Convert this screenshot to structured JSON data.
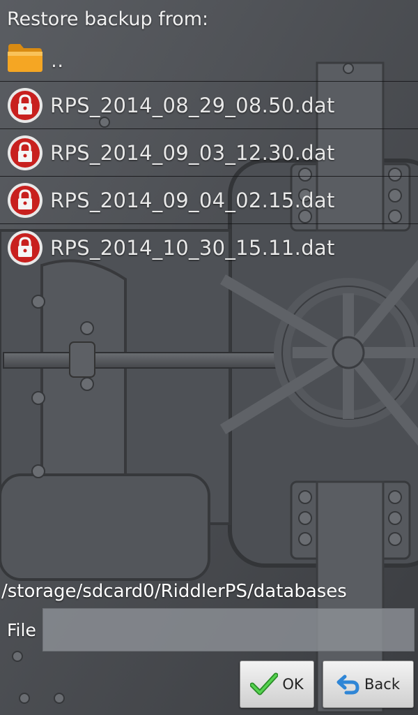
{
  "header": {
    "title": "Restore backup from:"
  },
  "list": {
    "parent_label": "..",
    "files": [
      {
        "name": "RPS_2014_08_29_08.50.dat"
      },
      {
        "name": "RPS_2014_09_03_12.30.dat"
      },
      {
        "name": "RPS_2014_09_04_02.15.dat"
      },
      {
        "name": "RPS_2014_10_30_15.11.dat"
      }
    ]
  },
  "footer": {
    "path": "/storage/sdcard0/RiddlerPS/databases",
    "file_label": "File",
    "file_value": "",
    "ok_label": "OK",
    "back_label": "Back"
  },
  "icons": {
    "folder": "folder-icon",
    "file": "locked-file-icon",
    "ok": "checkmark-icon",
    "back": "back-arrow-icon"
  },
  "colors": {
    "folder": "#f5a623",
    "locked_file": "#c8201e",
    "ok_check": "#3db83a",
    "back_arrow": "#2f86d6"
  }
}
